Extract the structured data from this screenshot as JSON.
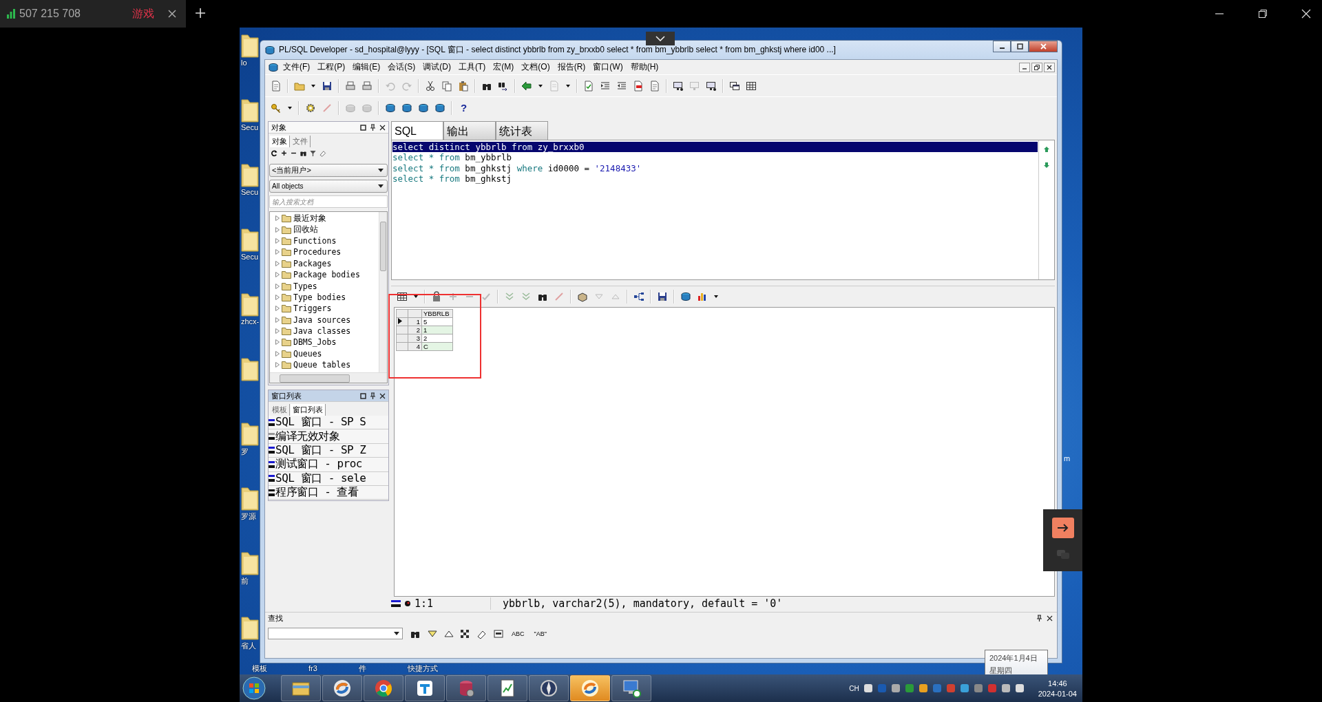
{
  "host_tab": {
    "title": "507 215 708",
    "badge": "游戏"
  },
  "desktop": {
    "icons": [
      {
        "kind": "folder",
        "label": "lo"
      },
      {
        "kind": "folder",
        "label": "Secu"
      },
      {
        "kind": "folder",
        "label": "Secu"
      },
      {
        "kind": "folder",
        "label": "Secu"
      },
      {
        "kind": "folder",
        "label": "zhcx-"
      },
      {
        "kind": "folder"
      },
      {
        "kind": "folder",
        "label": "罗"
      },
      {
        "kind": "folder",
        "label": "罗源"
      },
      {
        "kind": "folder",
        "label": "前"
      },
      {
        "kind": "folder",
        "label": "省人"
      }
    ],
    "bottom_labels": [
      "模板",
      "fr3",
      "件",
      "快捷方式"
    ],
    "right_label": "m"
  },
  "app": {
    "title": "PL/SQL Developer - sd_hospital@lyyy - [SQL 窗口 - select distinct ybbrlb from zy_brxxb0 select * from bm_ybbrlb select * from bm_ghkstj where id00 ...]",
    "menu": [
      "文件(F)",
      "工程(P)",
      "编辑(E)",
      "会话(S)",
      "调试(D)",
      "工具(T)",
      "宏(M)",
      "文档(O)",
      "报告(R)",
      "窗口(W)",
      "帮助(H)"
    ],
    "help_button": "?",
    "object_panel": {
      "title": "对象",
      "tabs": [
        {
          "label": "对象",
          "selected": true
        },
        {
          "label": "文件",
          "selected": false
        }
      ],
      "owner": "<当前用户>",
      "filter": "All objects",
      "search_placeholder": "输入搜索文档",
      "tree": [
        "最近对象",
        "回收站",
        "Functions",
        "Procedures",
        "Packages",
        "Package bodies",
        "Types",
        "Type bodies",
        "Triggers",
        "Java sources",
        "Java classes",
        "DBMS_Jobs",
        "Queues",
        "Queue tables"
      ]
    },
    "window_panel": {
      "title": "窗口列表",
      "tabs": [
        {
          "label": "模板",
          "selected": false
        },
        {
          "label": "窗口列表",
          "selected": true
        }
      ],
      "items": [
        {
          "label": "SQL 窗口 - SP S",
          "kind": "sql"
        },
        {
          "label": "编译无效对象",
          "kind": "compile"
        },
        {
          "label": "SQL 窗口 - SP Z",
          "kind": "sql"
        },
        {
          "label": "测试窗口 - proc",
          "kind": "test"
        },
        {
          "label": "SQL 窗口 - sele",
          "kind": "sql"
        },
        {
          "label": "程序窗口 - 查看",
          "kind": "program"
        }
      ]
    },
    "editor_tabs": [
      {
        "label": "SQL",
        "selected": true
      },
      {
        "label": "输出",
        "selected": false
      },
      {
        "label": "统计表",
        "selected": false
      }
    ],
    "sql_lines": [
      {
        "selected": true,
        "tokens": [
          {
            "text": "select",
            "kind": "keyword"
          },
          {
            "text": " distinct",
            "kind": "keyword"
          },
          {
            "text": " ybbrlb ",
            "kind": "plain"
          },
          {
            "text": "from",
            "kind": "keyword"
          },
          {
            "text": " zy_brxxb0",
            "kind": "plain"
          }
        ]
      },
      {
        "selected": false,
        "tokens": [
          {
            "text": "select * from",
            "kind": "keyword"
          },
          {
            "text": " bm_ybbrlb",
            "kind": "plain"
          }
        ]
      },
      {
        "selected": false,
        "tokens": [
          {
            "text": "select * from",
            "kind": "keyword"
          },
          {
            "text": " bm_ghkstj ",
            "kind": "plain"
          },
          {
            "text": "where",
            "kind": "keyword"
          },
          {
            "text": " id0000 = ",
            "kind": "plain"
          },
          {
            "text": "'2148433'",
            "kind": "string"
          }
        ]
      },
      {
        "selected": false,
        "tokens": [
          {
            "text": "select * from",
            "kind": "keyword"
          },
          {
            "text": " bm_ghkstj",
            "kind": "plain"
          }
        ]
      }
    ],
    "result_grid": {
      "columns": [
        "YBBRLB"
      ],
      "rows": [
        {
          "number": "1",
          "selected": true,
          "cells": [
            "5"
          ]
        },
        {
          "number": "2",
          "selected": false,
          "cells": [
            "1"
          ]
        },
        {
          "number": "3",
          "selected": false,
          "cells": [
            "2"
          ]
        },
        {
          "number": "4",
          "selected": false,
          "cells": [
            "C"
          ]
        }
      ]
    },
    "status_bar": {
      "position": "1:1",
      "message": "ybbrlb, varchar2(5), mandatory, default = '0'"
    },
    "find_panel": {
      "title": "查找",
      "buttons": [
        "ABC",
        "\"AB\""
      ]
    }
  },
  "tooltip": [
    "2024年1月4日",
    "星期四"
  ],
  "taskbar": {
    "apps": [
      {
        "selected": false
      },
      {
        "selected": false
      },
      {
        "selected": false
      },
      {
        "selected": false
      },
      {
        "selected": false
      },
      {
        "selected": false
      },
      {
        "selected": false
      },
      {
        "selected": true
      },
      {
        "selected": false
      }
    ],
    "language": "CH",
    "time": "14:46",
    "date": "2024-01-04"
  }
}
